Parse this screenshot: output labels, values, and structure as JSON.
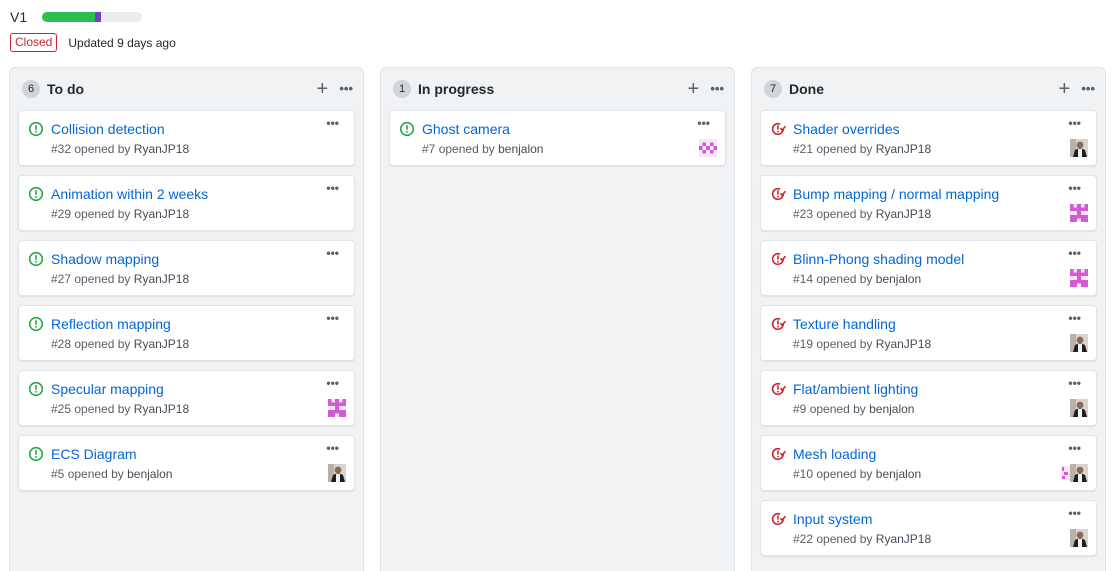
{
  "milestone": {
    "title": "V1",
    "status": "Closed",
    "updated": "Updated 9 days ago",
    "progress": {
      "done_percent": 53,
      "in_progress_percent": 6
    }
  },
  "colors": {
    "open": "#28a745",
    "closed": "#cb2431",
    "link": "#0366d6",
    "done_bar": "#2cbe4e",
    "progress_bar": "#6f42c1"
  },
  "columns": [
    {
      "count": "6",
      "name": "To do",
      "cards": [
        {
          "title": "Collision detection",
          "number": "#32",
          "opened_by": "opened by",
          "author": "RyanJP18",
          "state": "open",
          "avatar": ""
        },
        {
          "title": "Animation within 2 weeks",
          "number": "#29",
          "opened_by": "opened by",
          "author": "RyanJP18",
          "state": "open",
          "avatar": ""
        },
        {
          "title": "Shadow mapping",
          "number": "#27",
          "opened_by": "opened by",
          "author": "RyanJP18",
          "state": "open",
          "avatar": ""
        },
        {
          "title": "Reflection mapping",
          "number": "#28",
          "opened_by": "opened by",
          "author": "RyanJP18",
          "state": "open",
          "avatar": ""
        },
        {
          "title": "Specular mapping",
          "number": "#25",
          "opened_by": "opened by",
          "author": "RyanJP18",
          "state": "open",
          "avatar": "identicon"
        },
        {
          "title": "ECS Diagram",
          "number": "#5",
          "opened_by": "opened by",
          "author": "benjalon",
          "state": "open",
          "avatar": "photo"
        }
      ]
    },
    {
      "count": "1",
      "name": "In progress",
      "cards": [
        {
          "title": "Ghost camera",
          "number": "#7",
          "opened_by": "opened by",
          "author": "benjalon",
          "state": "open",
          "avatar": "identicon-small"
        }
      ]
    },
    {
      "count": "7",
      "name": "Done",
      "cards": [
        {
          "title": "Shader overrides",
          "number": "#21",
          "opened_by": "opened by",
          "author": "RyanJP18",
          "state": "closed",
          "avatar": "photo"
        },
        {
          "title": "Bump mapping / normal mapping",
          "number": "#23",
          "opened_by": "opened by",
          "author": "RyanJP18",
          "state": "closed",
          "avatar": "identicon"
        },
        {
          "title": "Blinn-Phong shading model",
          "number": "#14",
          "opened_by": "opened by",
          "author": "benjalon",
          "state": "closed",
          "avatar": "identicon"
        },
        {
          "title": "Texture handling",
          "number": "#19",
          "opened_by": "opened by",
          "author": "RyanJP18",
          "state": "closed",
          "avatar": "photo"
        },
        {
          "title": "Flat/ambient lighting",
          "number": "#9",
          "opened_by": "opened by",
          "author": "benjalon",
          "state": "closed",
          "avatar": "photo"
        },
        {
          "title": "Mesh loading",
          "number": "#10",
          "opened_by": "opened by",
          "author": "benjalon",
          "state": "closed",
          "avatar": "stacked"
        },
        {
          "title": "Input system",
          "number": "#22",
          "opened_by": "opened by",
          "author": "RyanJP18",
          "state": "closed",
          "avatar": "photo"
        }
      ]
    }
  ]
}
